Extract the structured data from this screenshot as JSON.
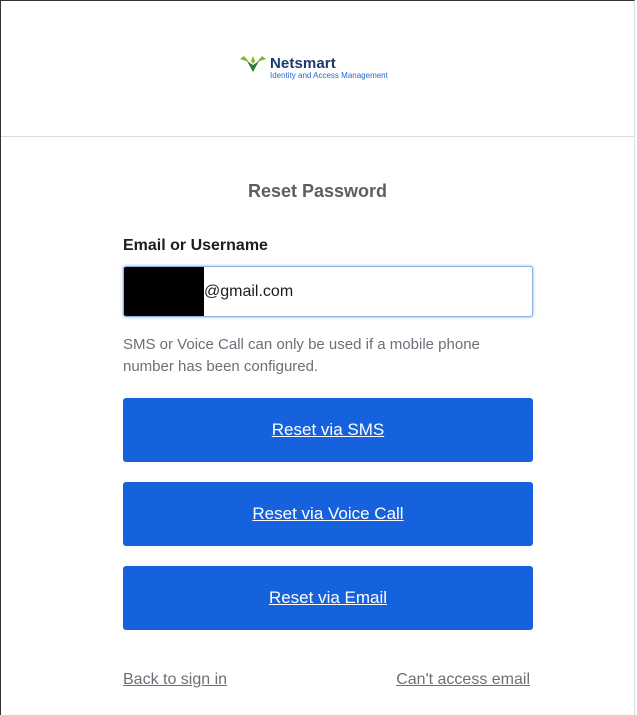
{
  "brand": {
    "name": "Netsmart",
    "subtitle": "Identity and Access Management",
    "colors": {
      "name": "#1b3a6b",
      "subtitle": "#1d6ad6",
      "leaf": "#7cb82f"
    }
  },
  "form": {
    "title": "Reset Password",
    "email_label": "Email or Username",
    "email_value": "@gmail.com",
    "hint": "SMS or Voice Call can only be used if a mobile phone number has been configured."
  },
  "buttons": {
    "sms": "Reset via SMS",
    "voice": "Reset via Voice Call",
    "email": "Reset via Email",
    "color": "#1662dd"
  },
  "links": {
    "back": "Back to sign in",
    "cant_access": "Can't access email"
  }
}
